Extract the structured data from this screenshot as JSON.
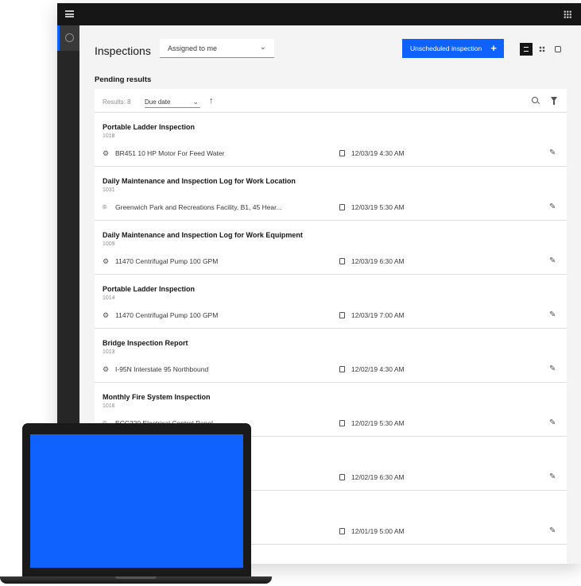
{
  "header": {
    "title": "Inspections"
  },
  "assignment_filter": {
    "selected": "Assigned to me"
  },
  "new_button": {
    "label": "Unscheduled inspection",
    "icon": "+"
  },
  "section": {
    "title": "Pending results"
  },
  "filterbar": {
    "results": "Results: 8",
    "sort_field": "Due date",
    "sort_direction": "↑"
  },
  "rows": [
    {
      "title": "Portable Ladder Inspection",
      "id": "1018",
      "asset": "BR451 10 HP Motor For Feed Water",
      "asset_icon": "asset-icon",
      "due": "12/03/19 4:30 AM"
    },
    {
      "title": "Daily Maintenance and Inspection Log for Work Location",
      "id": "1031",
      "asset": "Greenwich Park and Recreations Facility, B1, 45 Hear...",
      "asset_icon": "location-icon",
      "due": "12/03/19 5:30 AM"
    },
    {
      "title": "Daily Maintenance and Inspection Log for Work Equipment",
      "id": "1009",
      "asset": "11470 Centrifugal Pump 100 GPM",
      "asset_icon": "asset-icon",
      "due": "12/03/19 6:30 AM"
    },
    {
      "title": "Portable Ladder Inspection",
      "id": "1014",
      "asset": "11470 Centrifugal Pump 100 GPM",
      "asset_icon": "asset-icon",
      "due": "12/03/19 7:00 AM"
    },
    {
      "title": "Bridge Inspection Report",
      "id": "1013",
      "asset": "I-95N Interstate 95 Northbound",
      "asset_icon": "asset-icon",
      "due": "12/02/19 4:30 AM"
    },
    {
      "title": "Monthly Fire System Inspection",
      "id": "1016",
      "asset": "ECC220 Electrical Control Panel",
      "asset_icon": "location-icon",
      "due": "12/02/19 5:30 AM"
    },
    {
      "title": "",
      "id": "",
      "asset": "",
      "asset_icon": "",
      "due": "12/02/19 6:30 AM"
    },
    {
      "title": "",
      "id": "",
      "asset": "",
      "asset_icon": "",
      "due": "12/01/19 5:00 AM"
    }
  ],
  "colors": {
    "accent": "#0f62fe",
    "topbar": "#161616",
    "rail": "#262626",
    "background": "#f4f4f4"
  }
}
